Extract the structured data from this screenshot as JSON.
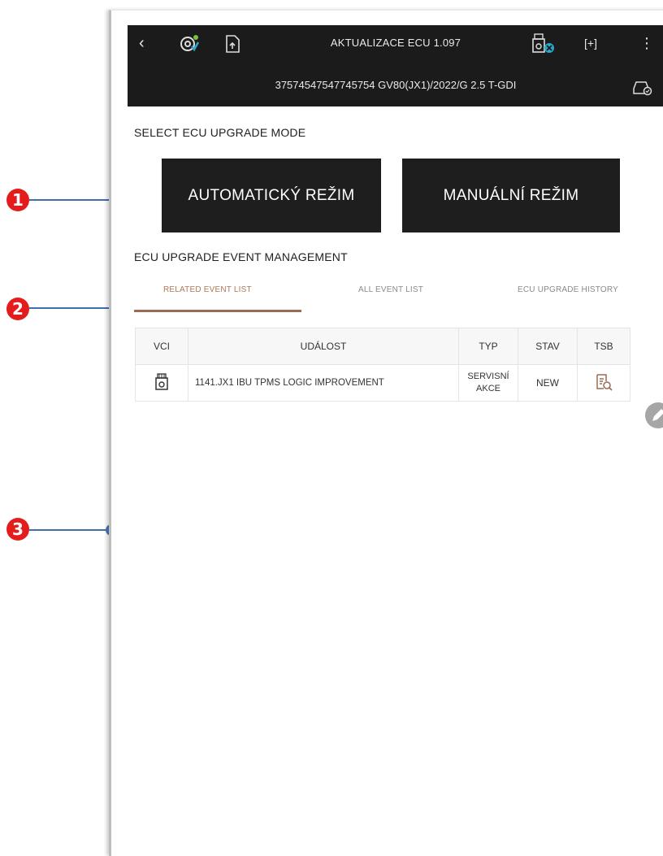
{
  "header": {
    "title": "AKTUALIZACE ECU 1.097",
    "vehicle_info": "37574547547745754  GV80(JX1)/2022/G 2.5 T-GDI"
  },
  "upgrade_mode": {
    "section_label": "SELECT ECU UPGRADE MODE",
    "auto_button": "AUTOMATICKÝ REŽIM",
    "manual_button": "MANUÁLNÍ REŽIM"
  },
  "event_management": {
    "section_label": "ECU UPGRADE EVENT MANAGEMENT",
    "tabs": [
      "RELATED EVENT LIST",
      "ALL EVENT LIST",
      "ECU UPGRADE HISTORY"
    ],
    "active_tab": "RELATED EVENT LIST"
  },
  "table": {
    "columns": [
      "VCI",
      "UDÁLOST",
      "TYP",
      "STAV",
      "TSB"
    ],
    "rows": [
      {
        "event": "1141.JX1 IBU TPMS LOGIC IMPROVEMENT",
        "type_line1": "SERVISNÍ",
        "type_line2": "AKCE",
        "status": "NEW"
      }
    ]
  },
  "annotations": [
    "1",
    "2",
    "3"
  ],
  "colors": {
    "topbar_bg": "#1b1b1b",
    "active_tab": "#b0785a",
    "status_new": "#2aa6c7",
    "annotation_badge": "#e41c1c",
    "annotation_line": "#3e6fae"
  },
  "icons": {
    "back": "chevron-left-icon",
    "vci_status": "vci-connected-icon",
    "upload": "upload-document-icon",
    "vci_device": "vci-device-icon",
    "fullscreen": "expand-icon",
    "more": "more-vert-icon",
    "vehicle": "vehicle-info-icon",
    "tsb": "document-search-icon"
  }
}
